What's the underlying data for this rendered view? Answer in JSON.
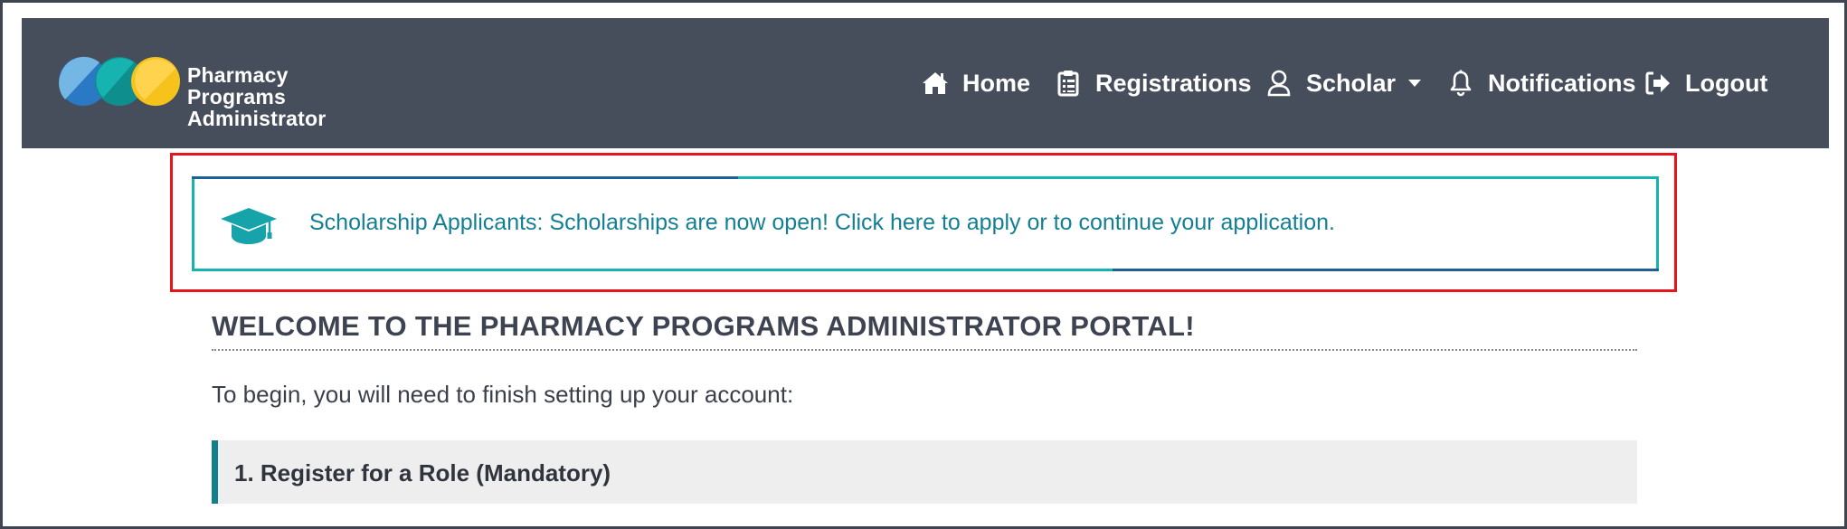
{
  "app": {
    "logo_line1": "Pharmacy Programs",
    "logo_line2": "Administrator"
  },
  "nav": {
    "items": [
      {
        "label": "Home",
        "icon": "home-icon"
      },
      {
        "label": "Registrations",
        "icon": "clipboard-icon"
      },
      {
        "label": "Scholar",
        "icon": "user-icon",
        "dropdown": true
      },
      {
        "label": "Notifications",
        "icon": "bell-icon"
      },
      {
        "label": "Logout",
        "icon": "logout-icon"
      }
    ]
  },
  "alert": {
    "text": "Scholarship Applicants: Scholarships are now open! Click here to apply or to continue your application.",
    "icon": "graduation-cap-icon"
  },
  "main": {
    "welcome_title": "WELCOME TO THE PHARMACY PROGRAMS ADMINISTRATOR PORTAL!",
    "intro_text": "To begin, you will need to finish setting up your account:",
    "steps": [
      {
        "label": "1. Register for a Role (Mandatory)"
      }
    ]
  },
  "colors": {
    "navbar": "#474e5b",
    "alert_border": "#16b3b3",
    "alert_text": "#137f93",
    "highlight_border": "#e8161c",
    "step_accent": "#137f8a"
  }
}
